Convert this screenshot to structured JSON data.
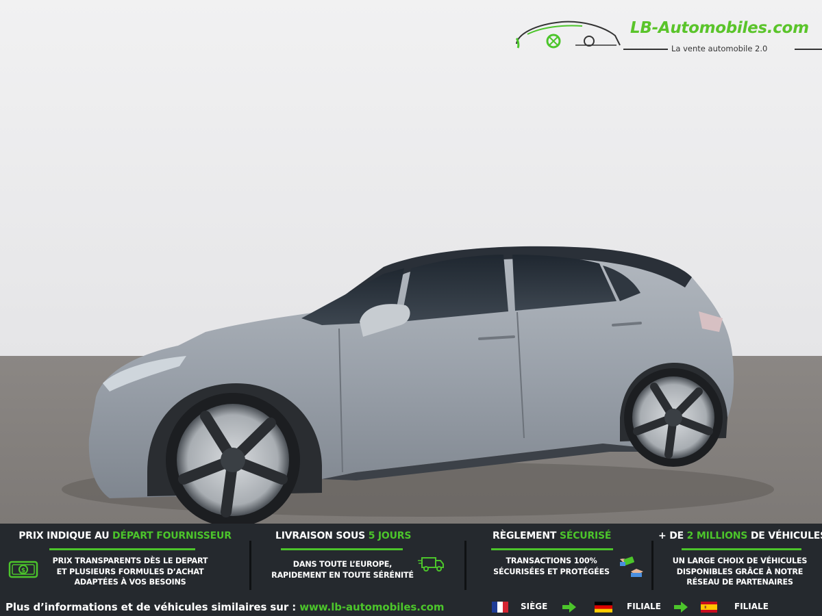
{
  "logo": {
    "brand": "LB-Automobiles.com",
    "tagline": "La vente automobile 2.0",
    "icon": "car-outline-logo-icon"
  },
  "colors": {
    "accent_green": "#4cc52b",
    "banner_bg": "#25292e",
    "car_body": "#9aa1a9",
    "studio_bg": "#e9e9ea",
    "floor": "#8a8582"
  },
  "banner": {
    "columns": [
      {
        "heading_prefix": "PRIX INDIQUE AU ",
        "heading_highlight": "DÉPART FOURNISSEUR",
        "heading_suffix": "",
        "text": "PRIX TRANSPARENTS DÈS LE DEPART\nET PLUSIEURS FORMULES D’ACHAT\nADAPTÉES À VOS BESOINS",
        "icon": "money-bill-icon"
      },
      {
        "heading_prefix": "LIVRAISON SOUS ",
        "heading_highlight": "5 JOURS",
        "heading_suffix": "",
        "text": "DANS TOUTE L’EUROPE,\nRAPIDEMENT EN TOUTE SÉRÉNITÉ",
        "icon": "delivery-truck-icon"
      },
      {
        "heading_prefix": "RÈGLEMENT ",
        "heading_highlight": "SÉCURISÉ",
        "heading_suffix": "",
        "text": "TRANSACTIONS 100%\nSÉCURISÉES ET PROTÉGÉES",
        "icon": "payment-hands-icon"
      },
      {
        "heading_prefix": "+ DE ",
        "heading_highlight": "2 MILLIONS",
        "heading_suffix": " DE VÉHICULES",
        "text": "UN LARGE CHOIX DE VÉHICULES\nDISPONIBLES GRÂCE À NOTRE\nRÉSEAU DE PARTENAIRES",
        "icon": ""
      }
    ],
    "info_prefix": "Plus d’informations et de véhicules similaires sur : ",
    "info_url": "www.lb-automobiles.com",
    "locations": [
      {
        "flag": "france-flag-icon",
        "label": "SIÈGE"
      },
      {
        "flag": "germany-flag-icon",
        "label": "FILIALE"
      },
      {
        "flag": "spain-flag-icon",
        "label": "FILIALE"
      }
    ]
  }
}
